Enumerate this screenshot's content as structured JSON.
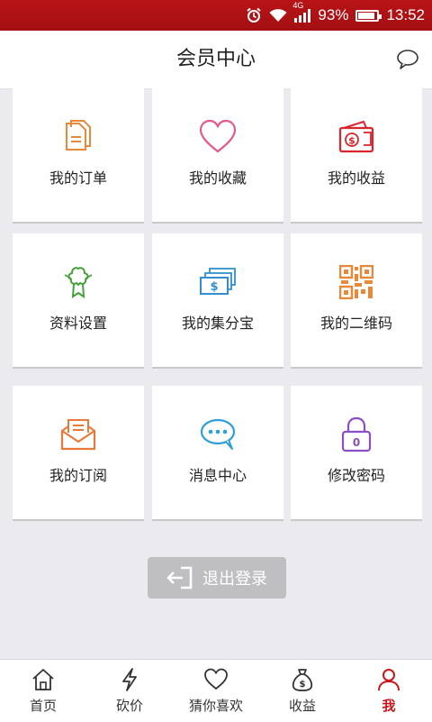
{
  "status_bar": {
    "network": "4G",
    "battery": "93%",
    "time": "13:52"
  },
  "header": {
    "title": "会员中心"
  },
  "grid": [
    {
      "label": "我的订单",
      "icon": "order-document-icon",
      "color": "#e8893a"
    },
    {
      "label": "我的收藏",
      "icon": "heart-icon",
      "color": "#e25a8c"
    },
    {
      "label": "我的收益",
      "icon": "wallet-money-icon",
      "color": "#d8262c"
    },
    {
      "label": "资料设置",
      "icon": "profile-badge-icon",
      "color": "#46a23c"
    },
    {
      "label": "我的集分宝",
      "icon": "cash-stack-icon",
      "color": "#2f8fd0"
    },
    {
      "label": "我的二维码",
      "icon": "qr-code-icon",
      "color": "#e8893a"
    },
    {
      "label": "我的订阅",
      "icon": "mail-envelope-icon",
      "color": "#e8793a"
    },
    {
      "label": "消息中心",
      "icon": "chat-bubble-icon",
      "color": "#2f9fd8"
    },
    {
      "label": "修改密码",
      "icon": "padlock-icon",
      "color": "#8a4fc8"
    }
  ],
  "logout": {
    "label": "退出登录"
  },
  "tabs": [
    {
      "label": "首页",
      "icon": "home-icon"
    },
    {
      "label": "砍价",
      "icon": "lightning-icon"
    },
    {
      "label": "猜你喜欢",
      "icon": "heart-icon"
    },
    {
      "label": "收益",
      "icon": "money-bag-icon"
    },
    {
      "label": "我",
      "icon": "user-icon",
      "active": true
    }
  ],
  "colors": {
    "status_bar": "#b01216",
    "tab_active": "#c8161c",
    "logout_bg": "#bfbfc2"
  }
}
